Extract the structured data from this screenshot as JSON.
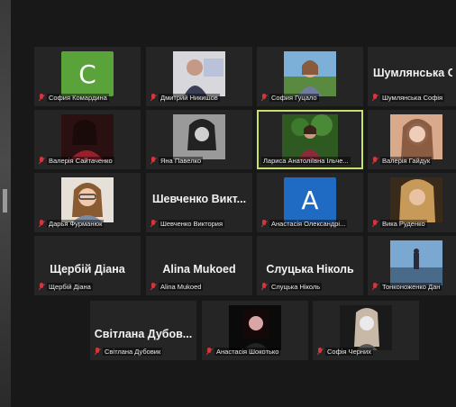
{
  "participants": [
    {
      "label": "София Комардина",
      "avatar_letter": "C",
      "avatar_color": "#5aa33a"
    },
    {
      "label": "Дмитрий Никишов"
    },
    {
      "label": "София Гуцало"
    },
    {
      "label": "Шумлянська Софія",
      "display_name": "Шумлянська С"
    },
    {
      "label": "Валерія Сайтаченко"
    },
    {
      "label": "Яна Павелко"
    },
    {
      "label": "Лариса Анатоліївна Ільче...",
      "active_speaker": true,
      "highlight_color": "#c7e26a"
    },
    {
      "label": "Валерія Гайдук"
    },
    {
      "label": "Дарья Фурманюк"
    },
    {
      "label": "Шевченко Виктория",
      "display_name": "Шевченко Викт..."
    },
    {
      "label": "Анастасія Олександрі...",
      "avatar_letter": "A",
      "avatar_color": "#1f6bc4"
    },
    {
      "label": "Вика Руденко"
    },
    {
      "label": "Щербій Діана",
      "display_name": "Щербій Діана"
    },
    {
      "label": "Alina Mukoed",
      "display_name": "Alina Mukoed"
    },
    {
      "label": "Слуцька Ніколь",
      "display_name": "Слуцька Ніколь"
    },
    {
      "label": "Тонконоженко Дан"
    },
    {
      "label": "Світлана Дубовик",
      "display_name": "Світлана Дубов..."
    },
    {
      "label": "Анастасія Шокотько"
    },
    {
      "label": "Софія Черних"
    }
  ],
  "mic_status_icon": "muted-mic-icon",
  "mic_muted_color": "#d3363b"
}
